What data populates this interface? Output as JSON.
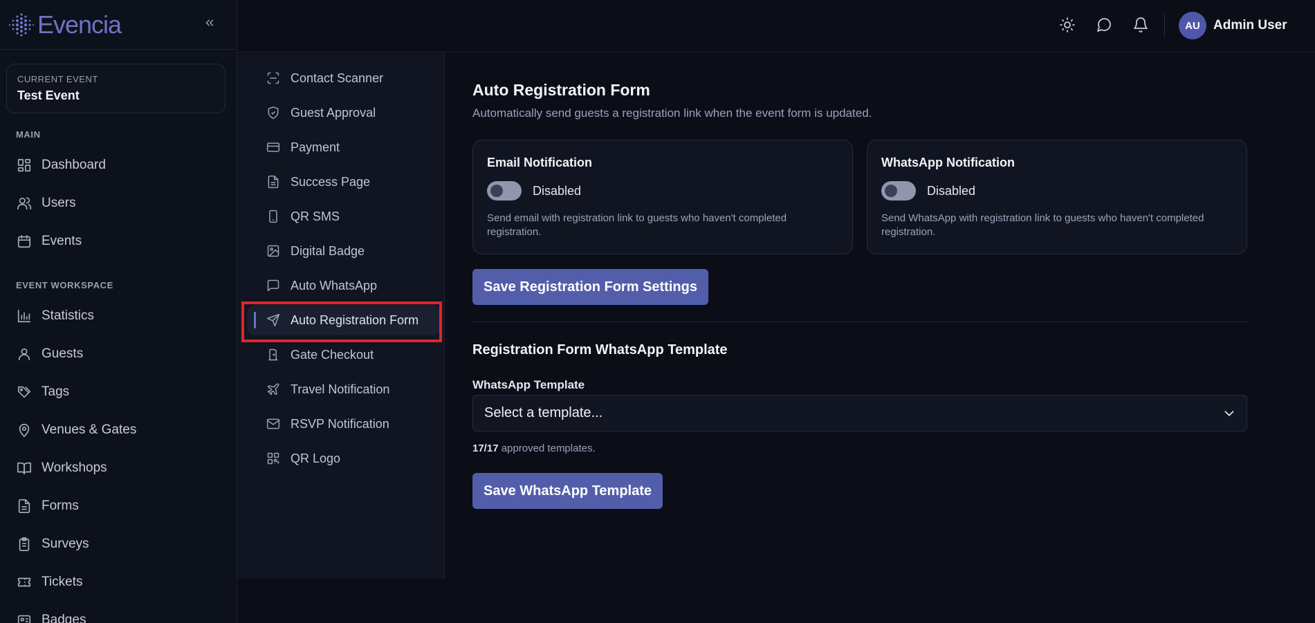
{
  "brand": {
    "name": "Evencia",
    "accent": "#6d74c4"
  },
  "sidebar": {
    "current_event_caption": "CURRENT EVENT",
    "current_event_name": "Test Event",
    "section_main": "MAIN",
    "main_items": [
      {
        "label": "Dashboard",
        "icon": "dashboard-icon"
      },
      {
        "label": "Users",
        "icon": "users-icon"
      },
      {
        "label": "Events",
        "icon": "calendar-icon"
      }
    ],
    "section_workspace": "EVENT WORKSPACE",
    "workspace_items": [
      {
        "label": "Statistics",
        "icon": "bar-chart-icon"
      },
      {
        "label": "Guests",
        "icon": "user-icon"
      },
      {
        "label": "Tags",
        "icon": "tags-icon"
      },
      {
        "label": "Venues & Gates",
        "icon": "map-pin-icon"
      },
      {
        "label": "Workshops",
        "icon": "book-open-icon"
      },
      {
        "label": "Forms",
        "icon": "file-text-icon"
      },
      {
        "label": "Surveys",
        "icon": "clipboard-icon"
      },
      {
        "label": "Tickets",
        "icon": "ticket-icon"
      },
      {
        "label": "Badges",
        "icon": "badge-icon"
      }
    ]
  },
  "topbar": {
    "avatar_initials": "AU",
    "user_name": "Admin User"
  },
  "subnav": {
    "items": [
      {
        "label": "Contact Scanner",
        "icon": "scan-icon"
      },
      {
        "label": "Guest Approval",
        "icon": "shield-check-icon"
      },
      {
        "label": "Payment",
        "icon": "credit-card-icon"
      },
      {
        "label": "Success Page",
        "icon": "file-text-icon"
      },
      {
        "label": "QR SMS",
        "icon": "smartphone-icon"
      },
      {
        "label": "Digital Badge",
        "icon": "image-icon"
      },
      {
        "label": "Auto WhatsApp",
        "icon": "message-square-icon"
      },
      {
        "label": "Auto Registration Form",
        "icon": "send-icon"
      },
      {
        "label": "Gate Checkout",
        "icon": "door-icon"
      },
      {
        "label": "Travel Notification",
        "icon": "plane-icon"
      },
      {
        "label": "RSVP Notification",
        "icon": "mail-icon"
      },
      {
        "label": "QR Logo",
        "icon": "qr-code-icon"
      }
    ],
    "active_index": 7
  },
  "main": {
    "title": "Auto Registration Form",
    "description": "Automatically send guests a registration link when the event form is updated.",
    "email_card": {
      "title": "Email Notification",
      "state": "Disabled",
      "hint": "Send email with registration link to guests who haven't completed registration."
    },
    "whatsapp_card": {
      "title": "WhatsApp Notification",
      "state": "Disabled",
      "hint": "Send WhatsApp with registration link to guests who haven't completed registration."
    },
    "save_form_button": "Save Registration Form Settings",
    "template_section_title": "Registration Form WhatsApp Template",
    "template_label": "WhatsApp Template",
    "template_placeholder": "Select a template...",
    "approved_count": "17/17",
    "approved_suffix": " approved templates.",
    "save_template_button": "Save WhatsApp Template"
  }
}
